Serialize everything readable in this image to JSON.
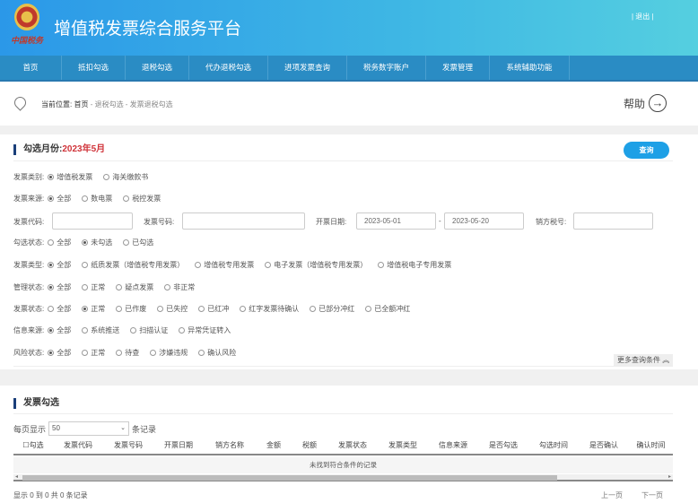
{
  "header": {
    "title": "增值税发票综合服务平台",
    "emblem_text": "中国税务",
    "logout": "| 退出 |"
  },
  "nav": [
    "首页",
    "抵扣勾选",
    "退税勾选",
    "代办退税勾选",
    "进项发票查询",
    "税务数字账户",
    "发票管理",
    "系统辅助功能"
  ],
  "breadcrumb": {
    "label": "当前位置:",
    "home": "首页",
    "path": " - 退税勾选 - 发票退税勾选",
    "help": "帮助",
    "help_icon": "arrow-right-circle-icon"
  },
  "query": {
    "title": "勾选月份:",
    "month": "2023年5月",
    "button": "查询",
    "invoice_category": {
      "label": "发票类别:",
      "options": [
        "增值税发票",
        "海关缴款书"
      ],
      "selected": 0
    },
    "invoice_source": {
      "label": "发票来源:",
      "options": [
        "全部",
        "数电票",
        "税控发票"
      ],
      "selected": 0
    },
    "invoice_code": {
      "label": "发票代码:",
      "value": ""
    },
    "invoice_number": {
      "label": "发票号码:",
      "value": ""
    },
    "issue_date": {
      "label": "开票日期:",
      "from": "2023-05-01",
      "sep": "-",
      "to": "2023-05-20"
    },
    "seller_tax_id": {
      "label": "销方税号:",
      "value": ""
    },
    "select_status": {
      "label": "勾选状态:",
      "options": [
        "全部",
        "未勾选",
        "已勾选"
      ],
      "selected": 1
    },
    "invoice_type": {
      "label": "发票类型:",
      "options": [
        "全部",
        "纸质发票（增值税专用发票）",
        "增值税专用发票",
        "电子发票（增值税专用发票）",
        "增值税电子专用发票"
      ],
      "selected": 0
    },
    "manage_status": {
      "label": "管理状态:",
      "options": [
        "全部",
        "正常",
        "疑点发票",
        "非正常"
      ],
      "selected": 0
    },
    "invoice_status": {
      "label": "发票状态:",
      "options": [
        "全部",
        "正常",
        "已作废",
        "已失控",
        "已红冲",
        "红字发票待确认",
        "已部分冲红",
        "已全额冲红"
      ],
      "selected": 1
    },
    "info_source": {
      "label": "信息来源:",
      "options": [
        "全部",
        "系统推送",
        "扫描认证",
        "异常凭证转入"
      ],
      "selected": 0
    },
    "risk_status": {
      "label": "风险状态:",
      "options": [
        "全部",
        "正常",
        "待查",
        "涉嫌违规",
        "确认风险"
      ],
      "selected": 0
    },
    "more": "更多查询条件 ︽"
  },
  "results": {
    "title": "发票勾选",
    "per_page_label": "每页显示",
    "per_page": "50",
    "records_label": "条记录",
    "columns": [
      "勾选",
      "发票代码",
      "发票号码",
      "开票日期",
      "销方名称",
      "金额",
      "税额",
      "发票状态",
      "发票类型",
      "信息来源",
      "是否勾选",
      "勾选时间",
      "是否确认",
      "确认时间"
    ],
    "empty": "未找到符合条件的记录",
    "summary": "显示 0 到 0 共 0 条记录",
    "prev": "上一页",
    "next": "下一页"
  }
}
